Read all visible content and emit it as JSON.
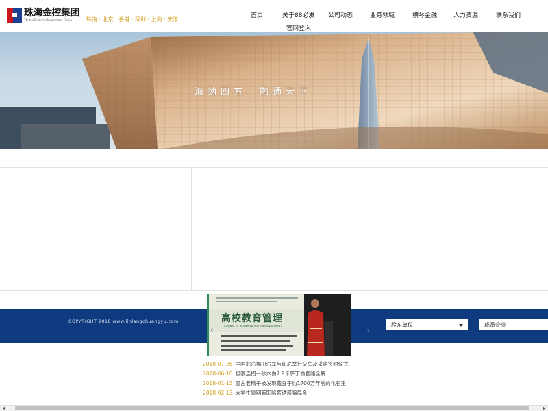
{
  "header": {
    "logo_text": "珠海金控集团",
    "logo_subtext": "Zhuhai Financial Investment Group",
    "cities": "珠海 · 北京 · 香港 · 深圳 · 上海 · 天津"
  },
  "nav": {
    "items": [
      {
        "label": "首页"
      },
      {
        "label": "关于88必发"
      },
      {
        "label": "公司动态"
      },
      {
        "label": "业务领域"
      },
      {
        "label": "横琴金融"
      },
      {
        "label": "人力资源"
      },
      {
        "label": "联系我们"
      },
      {
        "label": "官网登入"
      }
    ]
  },
  "banner": {
    "slogan": "海纳四方　融通天下"
  },
  "journal": {
    "title": "高校教育管理",
    "subtitle": "JOURNAL OF HIGHER EDUCATION MANAGEMENT"
  },
  "news": [
    {
      "date": "2018-07-26",
      "title": "中国北汽福田汽车与印尼举行交车及采购签约仪式"
    },
    {
      "date": "2018-06-10",
      "title": "极限连招一秒六伤7.9卡萨丁偷套路全解"
    },
    {
      "date": "2018-01-13",
      "title": "墨古老精子被发现藏身于约1700万年前的化石里"
    },
    {
      "date": "2018-02-13",
      "title": "大学生暑期兼职陷薪诱惑骗局多"
    }
  ],
  "footer": {
    "copyright": "COPYRIGHT 2018 www.linlangchuangyu.com",
    "select_shareholder": "股东单位",
    "select_member": "成员企业"
  },
  "colors": {
    "accent_gold": "#d4a021",
    "footer_blue": "#0f3a7f",
    "logo_red": "#c8161d",
    "logo_blue": "#1c3f94"
  }
}
